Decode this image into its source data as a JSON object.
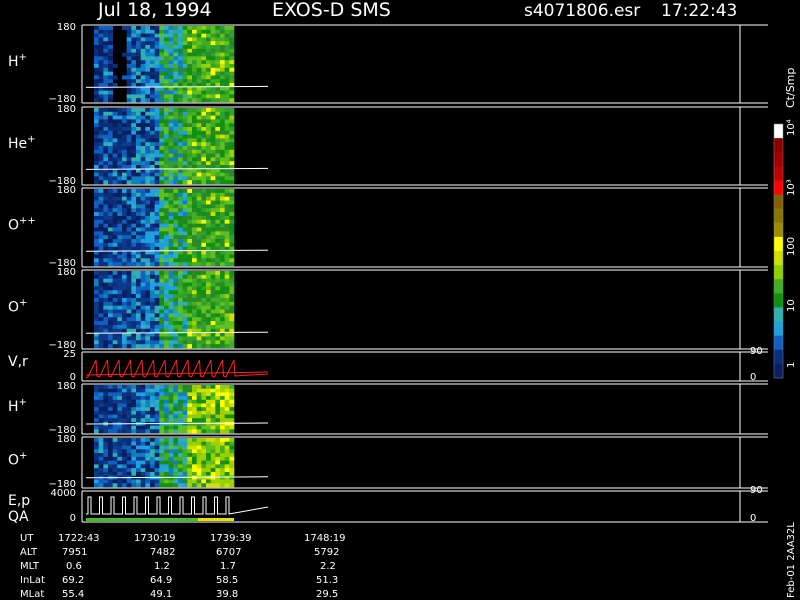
{
  "header": {
    "date": "Jul 18, 1994",
    "instrument": "EXOS-D SMS",
    "file": "s4071806.esr",
    "time": "17:22:43"
  },
  "panels": [
    {
      "label": "H",
      "sup": "+",
      "ytop": "180",
      "ybot": "−180",
      "kind": "spectrogram"
    },
    {
      "label": "He",
      "sup": "+",
      "ytop": "180",
      "ybot": "−180",
      "kind": "spectrogram"
    },
    {
      "label": "O",
      "sup": "++",
      "ytop": "180",
      "ybot": "−180",
      "kind": "spectrogram"
    },
    {
      "label": "O",
      "sup": "+",
      "ytop": "180",
      "ybot": "−180",
      "kind": "spectrogram",
      "rtick": "90"
    },
    {
      "label": "V,r",
      "sup": "",
      "ytop": "25",
      "ybot": "0",
      "kind": "line",
      "rtick": "0"
    },
    {
      "label": "H",
      "sup": "+",
      "ytop": "180",
      "ybot": "−180",
      "kind": "spectrogram"
    },
    {
      "label": "O",
      "sup": "+",
      "ytop": "180",
      "ybot": "−180",
      "kind": "spectrogram",
      "rtick": "90"
    },
    {
      "label": "E,p",
      "label2": "QA",
      "sup": "",
      "ytop": "4000",
      "ybot": "0",
      "kind": "line",
      "rtick": "0"
    }
  ],
  "colorbar": {
    "unit": "Ct/Smp",
    "ticks": [
      "10⁴",
      "10³",
      "100",
      "10",
      "1"
    ],
    "colors": [
      "#ffffff",
      "#8b0000",
      "#a00000",
      "#c00000",
      "#ff0000",
      "#806000",
      "#8b7500",
      "#a08a00",
      "#ffff00",
      "#d0e000",
      "#90d000",
      "#40b020",
      "#109010",
      "#30b0b0",
      "#20a0e0",
      "#1060c0",
      "#0a2f7a",
      "#081f60"
    ]
  },
  "footer": {
    "labels": [
      "UT",
      "ALT",
      "MLT",
      "InLat",
      "MLat"
    ],
    "columns": [
      [
        "1722:43",
        "7951",
        "0.6",
        "69.2",
        "55.4"
      ],
      [
        "1730:19",
        "7482",
        "1.2",
        "64.9",
        "49.1"
      ],
      [
        "1739:39",
        "6707",
        "1.7",
        "58.5",
        "39.8"
      ],
      [
        "1748:19",
        "5792",
        "2.2",
        "51.3",
        "29.5"
      ]
    ],
    "side_label": "Feb-01 2AA32L"
  },
  "chart_data": {
    "type": "heatmap",
    "title": "Jul 18, 1994   EXOS-D SMS",
    "x": [
      "1722:43",
      "1730:19",
      "1739:39",
      "1748:19"
    ],
    "series": [
      {
        "name": "H+",
        "ylim": [
          -180,
          180
        ]
      },
      {
        "name": "He+",
        "ylim": [
          -180,
          180
        ]
      },
      {
        "name": "O++",
        "ylim": [
          -180,
          180
        ]
      },
      {
        "name": "O+",
        "ylim": [
          -180,
          180
        ]
      },
      {
        "name": "V,r",
        "ylim": [
          0,
          25
        ]
      },
      {
        "name": "H+",
        "ylim": [
          -180,
          180
        ]
      },
      {
        "name": "O+",
        "ylim": [
          -180,
          180
        ]
      },
      {
        "name": "E,p",
        "ylim": [
          0,
          4000
        ]
      }
    ],
    "colorbar_label": "Ct/Smp",
    "colorbar_range": [
      1,
      10000
    ],
    "colorbar_scale": "log"
  }
}
